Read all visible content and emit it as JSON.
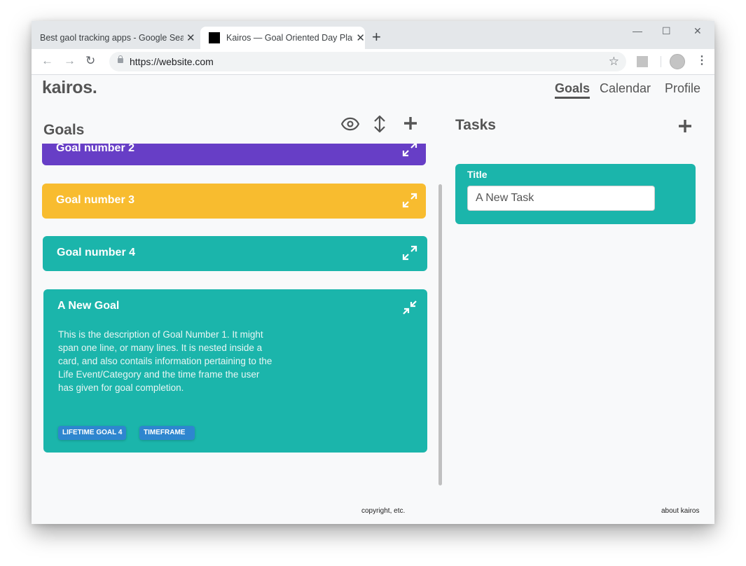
{
  "browser": {
    "tabs": [
      {
        "title": "Best gaol tracking apps - Google Search",
        "active": false
      },
      {
        "title": "Kairos — Goal Oriented Day Planner",
        "active": true
      }
    ],
    "new_tab_icon": "+",
    "window_controls": {
      "minimize": "—",
      "maximize": "☐",
      "close": "✕"
    },
    "url": "https://website.com",
    "nav": {
      "back": "←",
      "forward": "→",
      "reload": "↻"
    },
    "star_icon": "☆",
    "menu_icon": "⋮"
  },
  "app": {
    "logo": "kairos.",
    "nav": [
      {
        "label": "Goals",
        "active": true
      },
      {
        "label": "Calendar",
        "active": false
      },
      {
        "label": "Profile",
        "active": false
      }
    ]
  },
  "goals": {
    "title": "Goals",
    "cards": [
      {
        "title": "Goal number 2",
        "color": "#673ec6",
        "expanded": false
      },
      {
        "title": "Goal number 3",
        "color": "#f8bc2f",
        "expanded": false
      },
      {
        "title": "Goal number 4",
        "color": "#1bb5ab",
        "expanded": false
      },
      {
        "title": "A New Goal",
        "color": "#1bb5ab",
        "expanded": true,
        "description": "This is the description of Goal Number 1. It might span one line, or many lines. It is nested inside a card, and also contails information pertaining to the Life Event/Category and the time frame the user has given for goal completion.",
        "badges": [
          "LIFETIME GOAL 4",
          "TIMEFRAME"
        ],
        "badge_color": "#2e86cf"
      }
    ]
  },
  "tasks": {
    "title": "Tasks",
    "new_task": {
      "label": "Title",
      "value": "A New Task"
    },
    "card_color": "#1bb5ab"
  },
  "footer": {
    "copyright": "copyright, etc.",
    "about": "about kairos"
  }
}
